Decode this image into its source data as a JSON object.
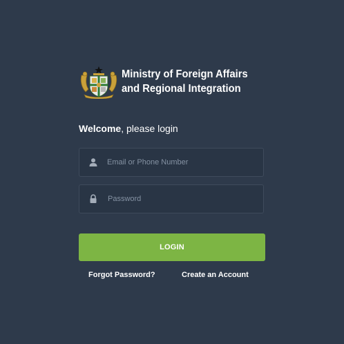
{
  "header": {
    "logo_icon": "ghana-coat-of-arms-icon",
    "ministry_line1": "Ministry of Foreign Affairs",
    "ministry_line2": "and Regional Integration"
  },
  "login_form": {
    "welcome_bold": "Welcome",
    "welcome_rest": ", please login",
    "email": {
      "icon": "user-icon",
      "placeholder": "Email or Phone Number",
      "value": ""
    },
    "password": {
      "icon": "lock-icon",
      "placeholder": "Password",
      "value": ""
    },
    "login_label": "LOGIN",
    "forgot_password_label": "Forgot Password?",
    "create_account_label": "Create an Account"
  },
  "colors": {
    "background": "#2e3a4b",
    "field_background": "#293545",
    "accent": "#7db544",
    "text": "#ffffff"
  }
}
